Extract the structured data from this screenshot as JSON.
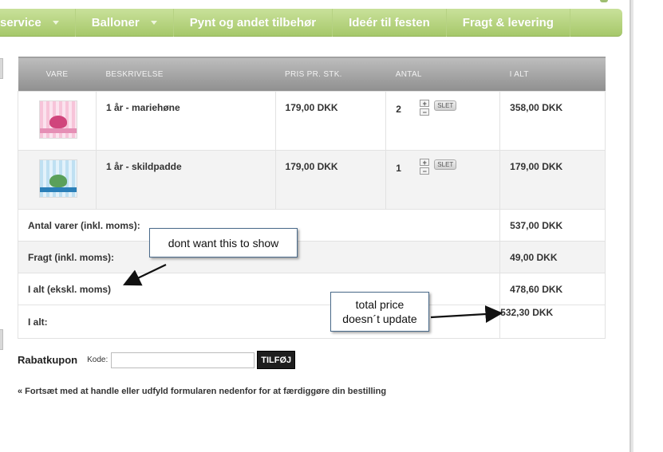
{
  "nav": {
    "items": [
      {
        "label": "service",
        "dropdown": true
      },
      {
        "label": "Balloner",
        "dropdown": true
      },
      {
        "label": "Pynt og andet tilbehør",
        "dropdown": false
      },
      {
        "label": "Ideér til festen",
        "dropdown": false
      },
      {
        "label": "Fragt & levering",
        "dropdown": false
      }
    ]
  },
  "cart": {
    "headers": {
      "vare": "VARE",
      "beskrivelse": "BESKRIVELSE",
      "pris": "PRIS PR. STK.",
      "antal": "ANTAL",
      "ialt": "I ALT"
    },
    "items": [
      {
        "description": "1 år - mariehøne",
        "price": "179,00 DKK",
        "quantity": "2",
        "total": "358,00 DKK",
        "delete_label": "SLET"
      },
      {
        "description": "1 år - skildpadde",
        "price": "179,00 DKK",
        "quantity": "1",
        "total": "179,00 DKK",
        "delete_label": "SLET"
      }
    ],
    "summary": [
      {
        "label": "Antal varer (inkl. moms):",
        "value": "537,00 DKK"
      },
      {
        "label": "Fragt (inkl. moms):",
        "value": "49,00 DKK"
      },
      {
        "label": "I alt (ekskl. moms)",
        "value": "478,60 DKK"
      },
      {
        "label": "I alt:",
        "value": "532,30 DKK"
      }
    ]
  },
  "coupon": {
    "label": "Rabatkupon",
    "code_label": "Kode:",
    "value": "",
    "button": "TILFØJ"
  },
  "continue_text": "« Fortsæt med at handle  eller udfyld formularen nedenfor for at færdiggøre din bestilling",
  "annotations": {
    "hide_note": "dont want this to show",
    "total_note_line1": "total price",
    "total_note_line2": "doesn´t update"
  },
  "colors": {
    "nav_green": "#a6c86a",
    "header_gray": "#8f8f8f"
  }
}
